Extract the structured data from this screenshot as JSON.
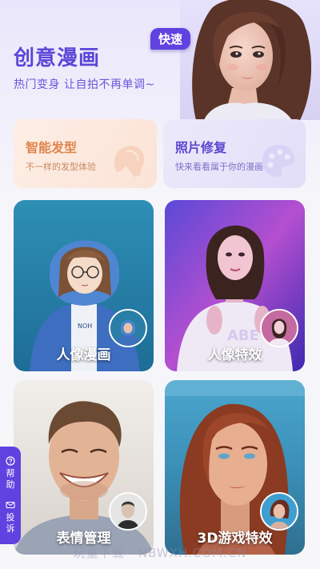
{
  "hero": {
    "title": "创意漫画",
    "subtitle": "热门变身 让自拍不再单调~",
    "badge": "快速"
  },
  "features": [
    {
      "title": "智能发型",
      "desc": "不一样的发型体验",
      "icon": "hair-silhouette-icon"
    },
    {
      "title": "照片修复",
      "desc": "快来看看属于你的漫画",
      "icon": "palette-icon"
    }
  ],
  "cards": [
    {
      "label": "人像漫画"
    },
    {
      "label": "人像特效"
    },
    {
      "label": "表情管理"
    },
    {
      "label": "3D游戏特效"
    }
  ],
  "help": {
    "help_label": "帮助",
    "feedback_label": "投诉",
    "help_icon": "question-circle-icon",
    "feedback_icon": "mail-icon"
  },
  "watermark": "玩童下载 · NBWXH.COM.CN",
  "colors": {
    "accent": "#5f42e0",
    "title": "#5b46d8",
    "hair_card": "#fbe3d6",
    "photo_card": "#e3def8"
  }
}
